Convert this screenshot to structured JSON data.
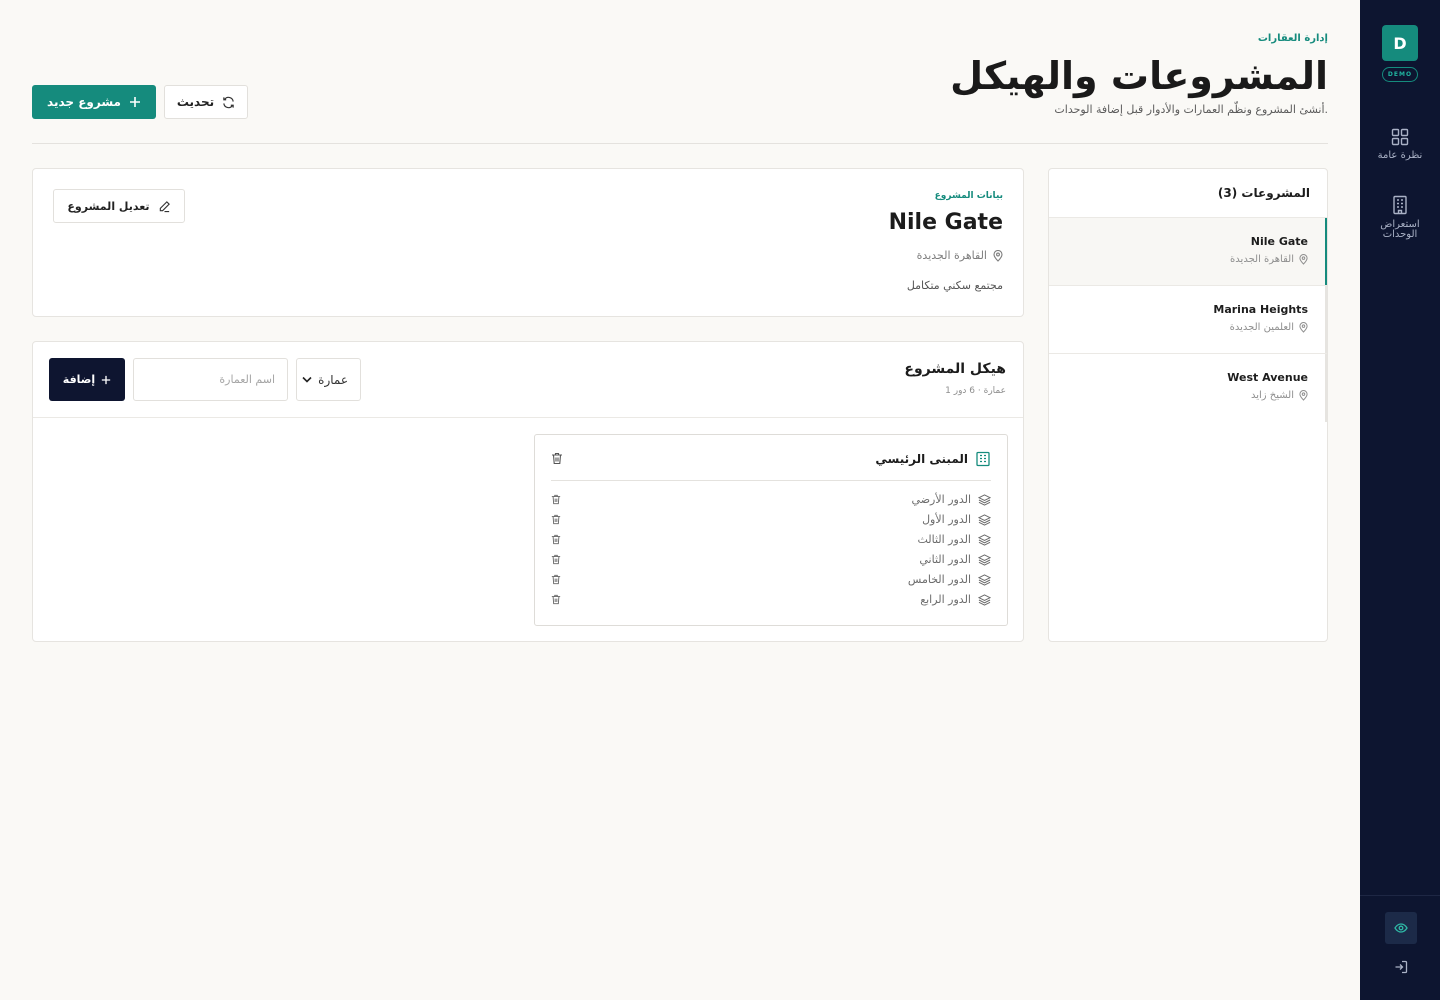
{
  "sidebar": {
    "logo_letter": "D",
    "badge": "DEMO",
    "nav": [
      {
        "label": "نظرة عامة",
        "icon": "grid-icon"
      },
      {
        "label": "استعراض الوحدات",
        "icon": "building-icon"
      }
    ],
    "bottom": [
      {
        "icon": "eye-icon"
      },
      {
        "icon": "logout-icon"
      }
    ]
  },
  "header": {
    "eyebrow": "إدارة العقارات",
    "title": "المشروعات والهيكل",
    "subtitle": "أنشئ المشروع ونظّم العمارات والأدوار قبل إضافة الوحدات.",
    "new_button": "مشروع جديد",
    "refresh_button": "تحديث"
  },
  "projects": {
    "heading": "المشروعات (3)",
    "items": [
      {
        "name": "Nile Gate",
        "location": "القاهرة الجديدة",
        "active": true
      },
      {
        "name": "Marina Heights",
        "location": "العلمين الجديدة",
        "active": false
      },
      {
        "name": "West Avenue",
        "location": "الشيخ زايد",
        "active": false
      }
    ]
  },
  "project_info": {
    "eyebrow": "بيانات المشروع",
    "name": "Nile Gate",
    "location": "القاهرة الجديدة",
    "description": "مجتمع سكني متكامل",
    "edit_button": "تعديل المشروع"
  },
  "structure": {
    "title": "هيكل المشروع",
    "meta": "1 عمارة · 6 دور",
    "type_select": "عمارة",
    "name_placeholder": "اسم العمارة",
    "add_button": "إضافة",
    "building": {
      "name": "المبنى الرئيسي",
      "floors": [
        "الدور الأرضي",
        "الدور الأول",
        "الدور الثالث",
        "الدور الثاني",
        "الدور الخامس",
        "الدور الرابع"
      ]
    }
  },
  "colors": {
    "accent": "#158b7d",
    "sidebar": "#0d1530",
    "background": "#faf9f6"
  }
}
